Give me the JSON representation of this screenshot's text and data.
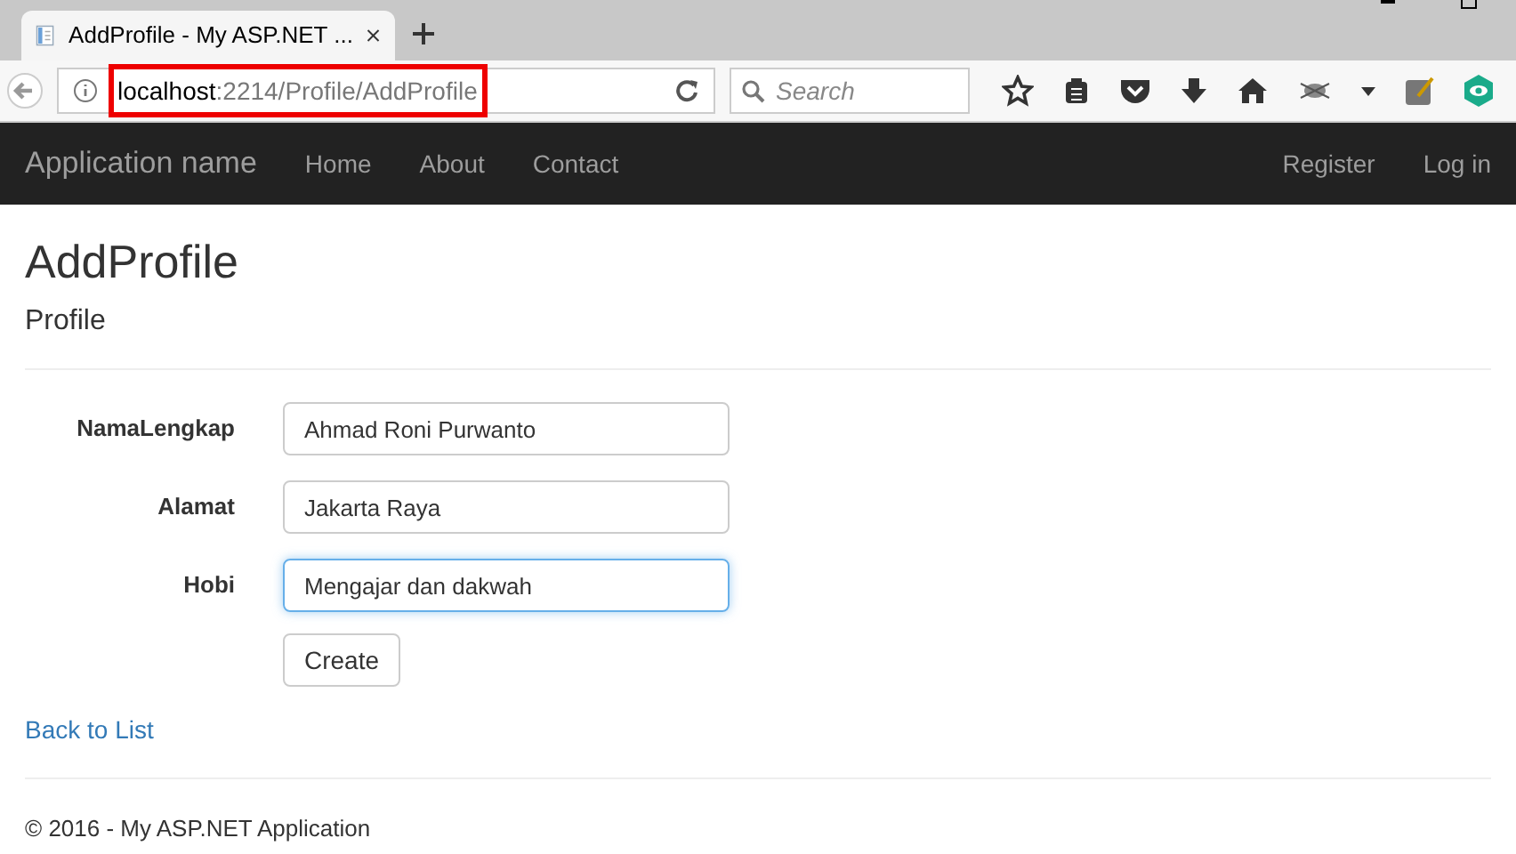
{
  "browser": {
    "tab_title": "AddProfile - My ASP.NET ...",
    "url_host": "localhost",
    "url_path": ":2214/Profile/AddProfile",
    "search_placeholder": "Search"
  },
  "navbar": {
    "brand": "Application name",
    "links": [
      "Home",
      "About",
      "Contact"
    ],
    "right_links": [
      "Register",
      "Log in"
    ]
  },
  "page": {
    "title": "AddProfile",
    "subtitle": "Profile"
  },
  "form": {
    "fields": [
      {
        "label": "NamaLengkap",
        "value": "Ahmad Roni Purwanto",
        "focused": false
      },
      {
        "label": "Alamat",
        "value": "Jakarta Raya",
        "focused": false
      },
      {
        "label": "Hobi",
        "value": "Mengajar dan dakwah",
        "focused": true
      }
    ],
    "submit": "Create"
  },
  "back_link": "Back to List",
  "footer": "© 2016 - My ASP.NET Application"
}
